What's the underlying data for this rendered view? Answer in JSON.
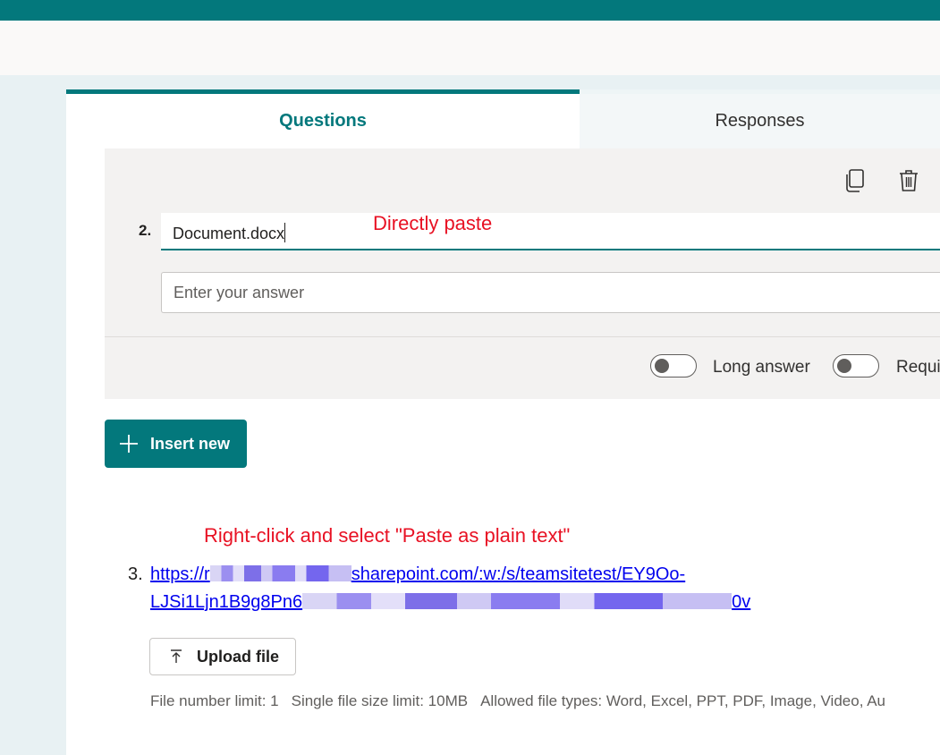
{
  "tabs": {
    "questions": "Questions",
    "responses": "Responses"
  },
  "question2": {
    "number": "2.",
    "title": "Document.docx",
    "answer_placeholder": "Enter your answer",
    "long_answer_label": "Long answer",
    "required_label": "Requi"
  },
  "annotations": {
    "direct_paste": "Directly paste",
    "plain_text_paste": "Right-click and select \"Paste as plain text\""
  },
  "insert_new_label": "Insert new",
  "question3": {
    "number": "3.",
    "link_line1_prefix": "https://r",
    "link_line1_suffix": "sharepoint.com/:w:/s/teamsitetest/EY9Oo-",
    "link_line2": "LJSi1Ljn1B9g8Pn6",
    "link_line2_tail": "0v",
    "upload_label": "Upload file",
    "file_number_limit": "File number limit: 1",
    "file_size_limit": "Single file size limit: 10MB",
    "allowed_types": "Allowed file types: Word, Excel, PPT, PDF, Image, Video, Au"
  },
  "icons": {
    "copy": "copy-icon",
    "delete": "trash-icon",
    "insert": "plus-icon",
    "upload": "upload-arrow-icon"
  },
  "colors": {
    "brand": "#03787c",
    "annotation": "#e81123",
    "link": "#0000ee"
  }
}
